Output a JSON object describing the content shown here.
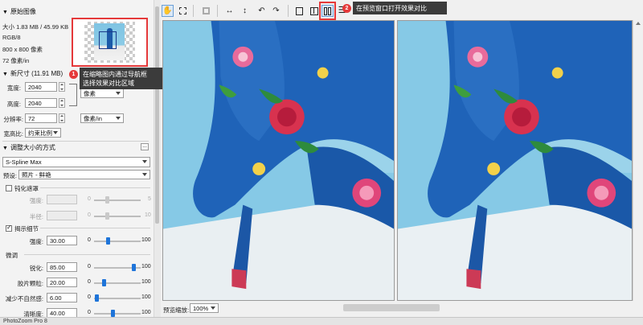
{
  "left_panel": {
    "original_section": {
      "title": "原始图像"
    },
    "info": {
      "size": "大小 1.83 MB / 45.99 KB",
      "mode": "RGB/8",
      "dimensions": "800 x 800 像素",
      "resolution": "72 像素/in"
    },
    "new_size_section": {
      "title": "新尺寸 (11.91 MB)"
    },
    "width": {
      "label": "宽度:",
      "value": "2040",
      "unit": "像素"
    },
    "height": {
      "label": "高度:",
      "value": "2040"
    },
    "resolution": {
      "label": "分辨率:",
      "value": "72",
      "unit": "像素/in"
    },
    "aspect": {
      "label": "宽高比:",
      "value": "约束比例"
    },
    "resize_method_section": {
      "title": "调整大小的方式",
      "more_button": "..."
    },
    "method": {
      "value": "S-Spline Max"
    },
    "preset": {
      "label": "预设:",
      "value": "照片 - 鲜艳"
    },
    "soften": {
      "label": "钝化遮罩",
      "checked": false,
      "strength": {
        "label": "强度:",
        "min": "0",
        "max": "5"
      },
      "radius": {
        "label": "半径:",
        "min": "0",
        "max": "10"
      }
    },
    "detail": {
      "label": "揭示细节",
      "checked": true,
      "strength": {
        "label": "强度:",
        "value": "30.00",
        "min": "0",
        "max": "100",
        "level": 0.3
      }
    },
    "fine_tune": {
      "title": "微调",
      "sharpen": {
        "label": "锐化:",
        "value": "85.00",
        "min": "0",
        "max": "100",
        "level": 0.85
      },
      "grain": {
        "label": "胶片颗粒:",
        "value": "20.00",
        "min": "0",
        "max": "100",
        "level": 0.2
      },
      "artifact": {
        "label": "减少不自然感:",
        "value": "6.00",
        "min": "0",
        "max": "100",
        "level": 0.06
      },
      "smooth": {
        "label": "清晰度:",
        "value": "40.00",
        "min": "0",
        "max": "100",
        "level": 0.4
      }
    }
  },
  "annotations": {
    "thumb_callout": {
      "badge": "1",
      "line1": "在缩略图内通过导航框",
      "line2": "选择效果对比区域"
    },
    "toolbar_callout": {
      "badge": "2",
      "text": "在预览窗口打开效果对比"
    }
  },
  "toolbar": {
    "icons": [
      "hand-tool-icon",
      "marquee-tool-icon",
      "crop-icon",
      "flip-horizontal-icon",
      "flip-vertical-icon",
      "rotate-left-icon",
      "rotate-right-icon",
      "single-view-icon",
      "split-compare-icon",
      "list-view-icon"
    ]
  },
  "preview": {
    "zoom_label": "预览缩放:",
    "zoom_value": "100%"
  },
  "status": {
    "app_name": "PhotoZoom Pro 8"
  },
  "colors": {
    "accent": "#e5393a",
    "slider": "#1e74d9",
    "sky": "#86c9e6",
    "shoe_blue": "#1f63b8"
  }
}
